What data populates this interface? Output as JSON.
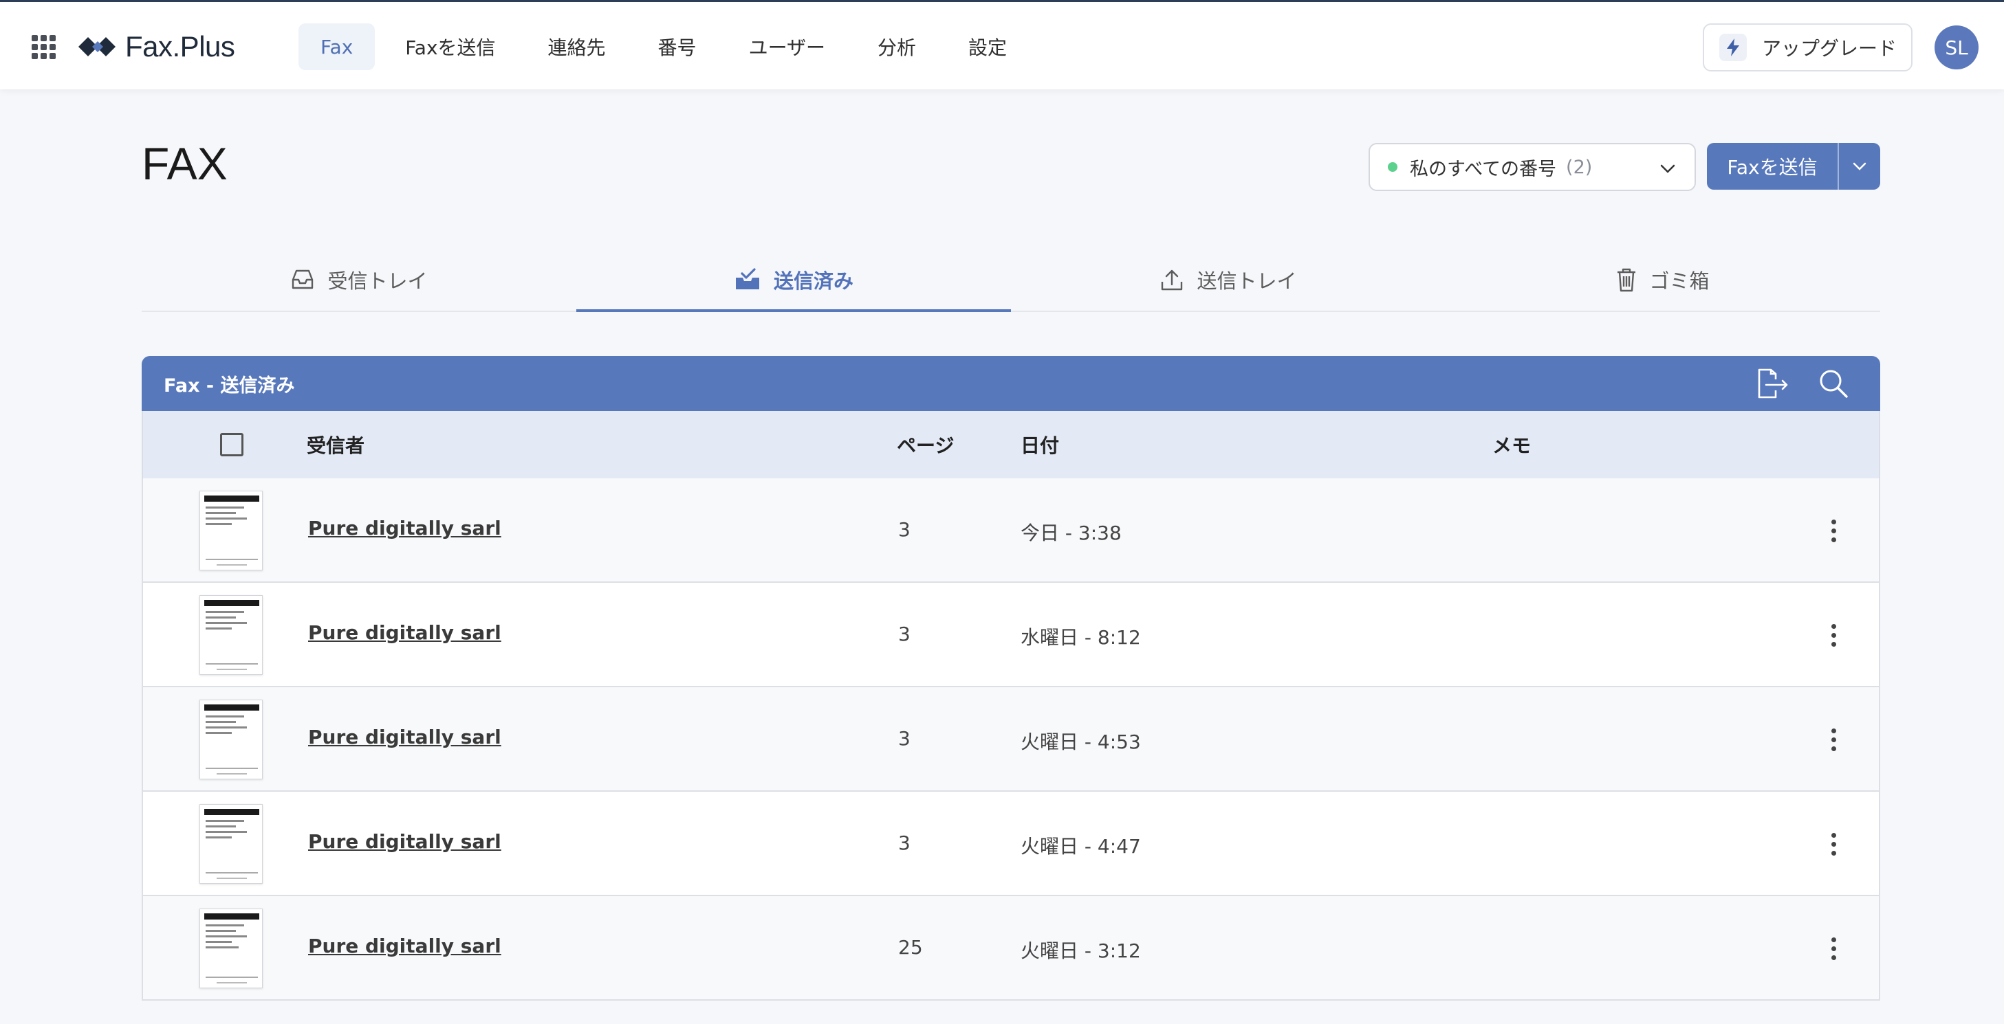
{
  "app": {
    "brand": "Fax.Plus",
    "accent_color": "#5878bc"
  },
  "nav": {
    "items": [
      {
        "label": "Fax",
        "active": true
      },
      {
        "label": "Faxを送信",
        "active": false
      },
      {
        "label": "連絡先",
        "active": false
      },
      {
        "label": "番号",
        "active": false
      },
      {
        "label": "ユーザー",
        "active": false
      },
      {
        "label": "分析",
        "active": false
      },
      {
        "label": "設定",
        "active": false
      }
    ],
    "upgrade_label": "アップグレード",
    "avatar_initials": "SL"
  },
  "header": {
    "title": "FAX",
    "number_select": {
      "label": "私のすべての番号",
      "count": "(2)"
    },
    "send_button": "Faxを送信"
  },
  "tabs": [
    {
      "label": "受信トレイ",
      "icon": "inbox-icon",
      "active": false
    },
    {
      "label": "送信済み",
      "icon": "sent-check-icon",
      "active": true
    },
    {
      "label": "送信トレイ",
      "icon": "upload-icon",
      "active": false
    },
    {
      "label": "ゴミ箱",
      "icon": "trash-icon",
      "active": false
    }
  ],
  "table": {
    "title": "Fax - 送信済み",
    "columns": {
      "recipient": "受信者",
      "pages": "ページ",
      "date": "日付",
      "memo": "メモ"
    },
    "rows": [
      {
        "recipient": "Pure digitally sarl",
        "pages": "3",
        "date": "今日 - 3:38",
        "memo": ""
      },
      {
        "recipient": "Pure digitally sarl",
        "pages": "3",
        "date": "水曜日 - 8:12",
        "memo": ""
      },
      {
        "recipient": "Pure digitally sarl",
        "pages": "3",
        "date": "火曜日 - 4:53",
        "memo": ""
      },
      {
        "recipient": "Pure digitally sarl",
        "pages": "3",
        "date": "火曜日 - 4:47",
        "memo": ""
      },
      {
        "recipient": "Pure digitally sarl",
        "pages": "25",
        "date": "火曜日 - 3:12",
        "memo": ""
      }
    ]
  }
}
